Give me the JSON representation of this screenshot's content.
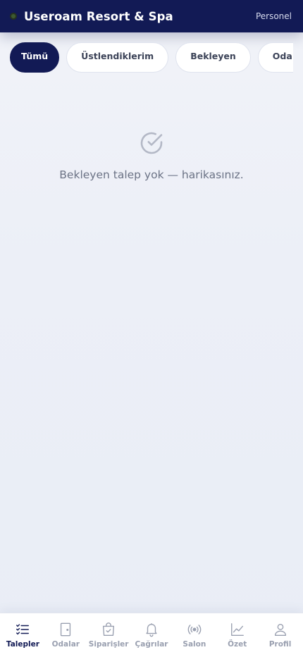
{
  "header": {
    "title": "Useroam Resort & Spa",
    "role": "Personel"
  },
  "filters": [
    {
      "label": "Tümü",
      "active": true
    },
    {
      "label": "Üstlendiklerim",
      "active": false
    },
    {
      "label": "Bekleyen",
      "active": false
    },
    {
      "label": "Oda Servisi",
      "active": false
    }
  ],
  "empty_state": {
    "icon": "check-circle-icon",
    "message": "Bekleyen talep yok — harikasınız."
  },
  "bottom_nav": [
    {
      "label": "Talepler",
      "icon": "list-check-icon",
      "active": true
    },
    {
      "label": "Odalar",
      "icon": "door-icon",
      "active": false
    },
    {
      "label": "Siparişler",
      "icon": "shopping-bag-icon",
      "active": false
    },
    {
      "label": "Çağrılar",
      "icon": "bell-icon",
      "active": false
    },
    {
      "label": "Salon",
      "icon": "broadcast-icon",
      "active": false
    },
    {
      "label": "Özet",
      "icon": "chart-icon",
      "active": false
    },
    {
      "label": "Profil",
      "icon": "user-icon",
      "active": false
    }
  ],
  "colors": {
    "brand": "#121a55",
    "inactive": "#9aa0b0",
    "background": "#eceff6"
  }
}
